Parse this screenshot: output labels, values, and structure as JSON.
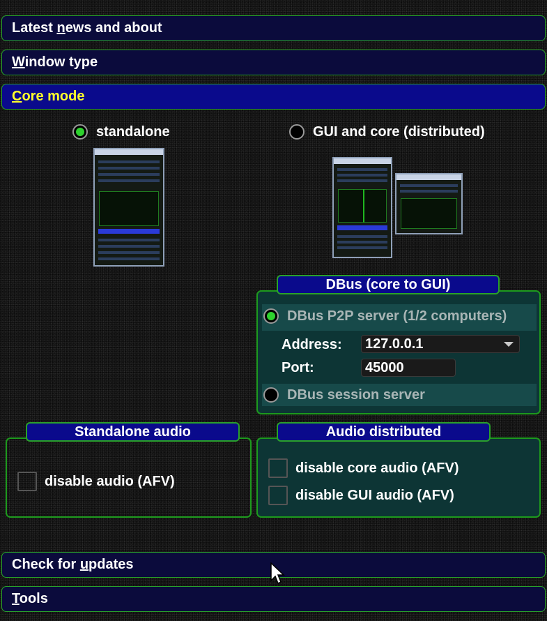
{
  "sections": {
    "news": {
      "pre": "Latest ",
      "key": "n",
      "post": "ews and about"
    },
    "window_type": {
      "pre": "",
      "key": "W",
      "post": "indow type"
    },
    "core_mode": {
      "pre": "",
      "key": "C",
      "post": "ore mode"
    },
    "updates": {
      "pre": "Check for ",
      "key": "u",
      "post": "pdates"
    },
    "tools": {
      "pre": "",
      "key": "T",
      "post": "ools"
    }
  },
  "core_mode": {
    "standalone_label": "standalone",
    "standalone_selected": true,
    "distributed_label": "GUI and core (distributed)",
    "distributed_selected": false
  },
  "dbus": {
    "title": "DBus (core to GUI)",
    "p2p_label": "DBus P2P server (1/2 computers)",
    "p2p_selected": true,
    "address_label": "Address:",
    "address_value": "127.0.0.1",
    "port_label": "Port:",
    "port_value": "45000",
    "session_label": "DBus session server",
    "session_selected": false
  },
  "standalone_audio": {
    "title": "Standalone audio",
    "disable_audio_label": "disable audio (AFV)",
    "disable_audio_checked": false
  },
  "audio_distributed": {
    "title": "Audio distributed",
    "disable_core_label": "disable core audio (AFV)",
    "disable_core_checked": false,
    "disable_gui_label": "disable GUI audio (AFV)",
    "disable_gui_checked": false
  },
  "colors": {
    "accent_green": "#2ed12e",
    "active_header_text": "#ffff2a",
    "header_blue": "#0a0a8c",
    "group_teal": "#0d3535"
  }
}
